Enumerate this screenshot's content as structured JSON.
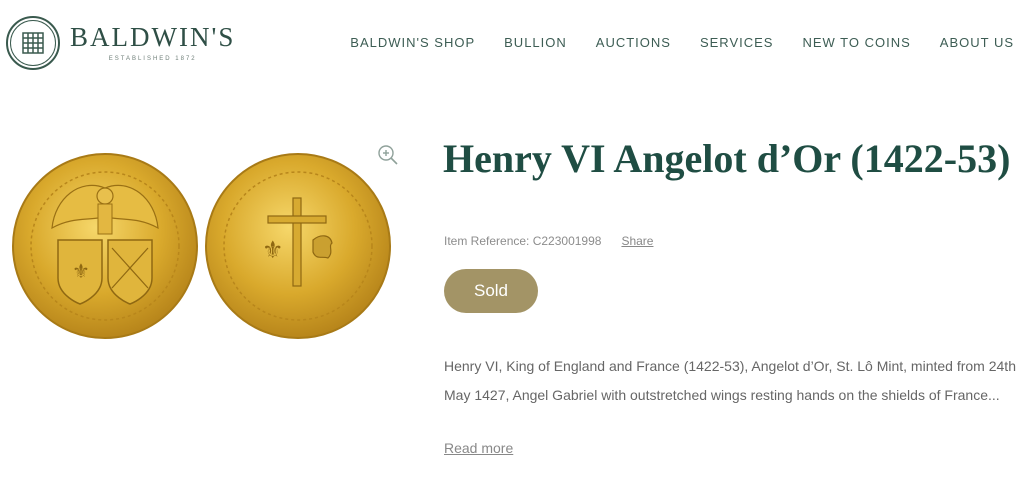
{
  "header": {
    "logo": {
      "name": "BALDWIN'S",
      "tagline": "ESTABLISHED 1872"
    },
    "nav": [
      {
        "label": "BALDWIN'S SHOP"
      },
      {
        "label": "BULLION"
      },
      {
        "label": "AUCTIONS"
      },
      {
        "label": "SERVICES"
      },
      {
        "label": "NEW TO COINS"
      },
      {
        "label": "ABOUT US"
      }
    ]
  },
  "product": {
    "title": "Henry VI Angelot d’Or (1422-53)",
    "reference": "Item Reference: C223001998",
    "share_label": "Share",
    "status": "Sold",
    "description": "Henry VI, King of England and France (1422-53), Angelot d’Or, St. Lô Mint, minted from 24th May 1427, Angel Gabriel with outstretched wings resting hands on the shields of France...",
    "read_more": "Read more",
    "icons": {
      "zoom": "zoom-in-icon",
      "obverse": "coin-obverse-image",
      "reverse": "coin-reverse-image"
    }
  },
  "colors": {
    "brand_green": "#1f4d43",
    "nav_text": "#3d5d54",
    "sold_badge": "#a39466",
    "coin_gold": "#d4a52a"
  }
}
